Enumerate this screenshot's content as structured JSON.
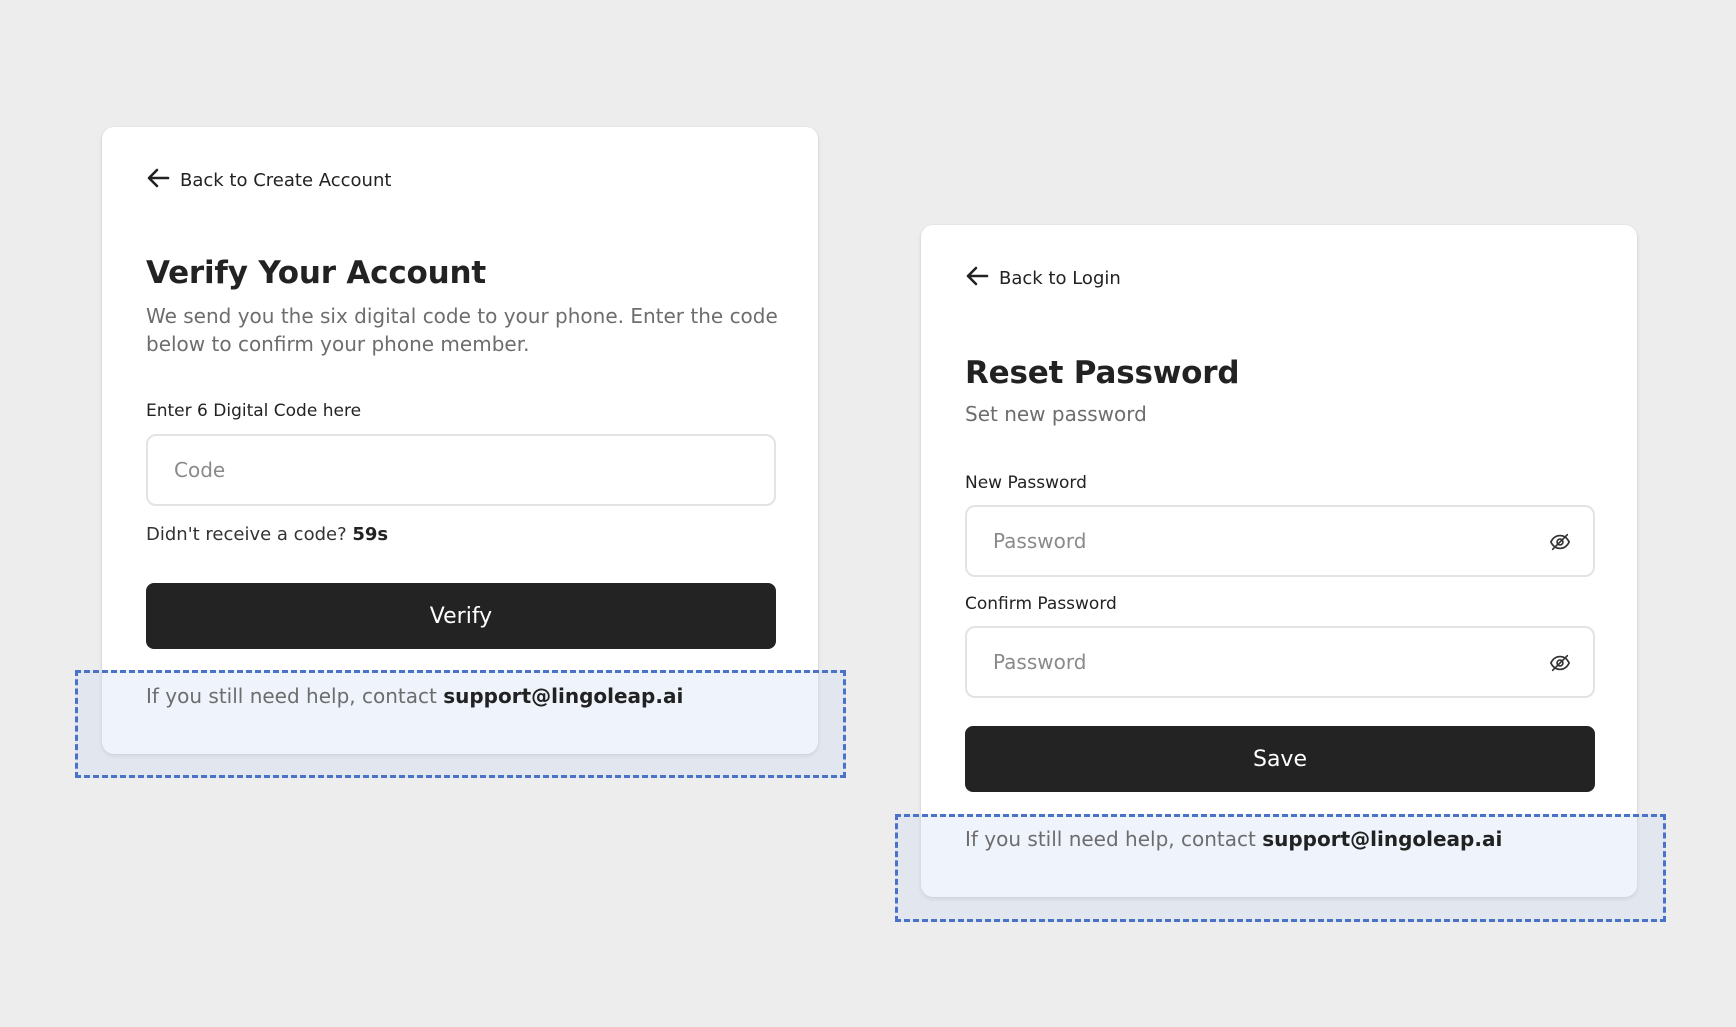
{
  "verify_card": {
    "back_label": "Back to Create Account",
    "title": "Verify Your Account",
    "description": "We send you the six digital code to your phone. Enter the code below to confirm your phone member.",
    "code_label": "Enter 6 Digital Code here",
    "code_placeholder": "Code",
    "code_value": "",
    "resend_text": "Didn't receive a code?",
    "resend_timer": "59s",
    "verify_label": "Verify",
    "help_prefix": "If you still need help, contact",
    "help_email": "support@lingoleap.ai"
  },
  "reset_card": {
    "back_label": "Back to Login",
    "title": "Reset Password",
    "subtitle": "Set new password",
    "new_password_label": "New Password",
    "new_password_placeholder": "Password",
    "confirm_password_label": "Confirm Password",
    "confirm_password_placeholder": "Password",
    "save_label": "Save",
    "help_prefix": "If you still need help, contact",
    "help_email": "support@lingoleap.ai"
  },
  "icons": {
    "back": "arrow-left-icon",
    "toggle_visibility": "eye-off-icon"
  },
  "colors": {
    "page_background": "#ededed",
    "card_background": "#ffffff",
    "primary_button": "#232323",
    "muted_text": "#6d6d6d",
    "highlight_border": "#4a72c8",
    "highlight_fill": "#c6d6f5"
  }
}
